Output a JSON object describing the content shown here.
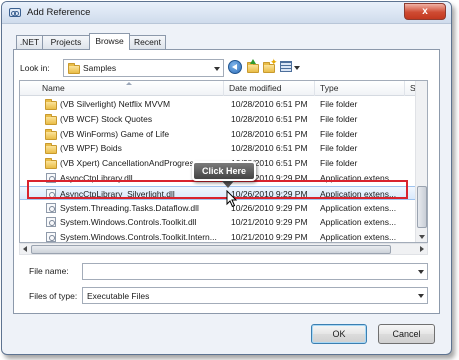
{
  "window": {
    "title": "Add Reference",
    "close_glyph": "x"
  },
  "tabs": [
    {
      "label": ".NET",
      "active": false
    },
    {
      "label": "Projects",
      "active": false
    },
    {
      "label": "Browse",
      "active": true
    },
    {
      "label": "Recent",
      "active": false
    }
  ],
  "lookin": {
    "label": "Look in:",
    "value": "Samples"
  },
  "toolbar": {
    "icons": [
      "back-arrow-icon",
      "up-folder-icon",
      "new-folder-icon",
      "views-menu-icon"
    ]
  },
  "list": {
    "columns": [
      "Name",
      "Date modified",
      "Type",
      "Si"
    ],
    "rows": [
      {
        "name": "(VB Silverlight) Netflix MVVM",
        "date": "10/28/2010 6:51 PM",
        "type": "File folder",
        "icon": "folder"
      },
      {
        "name": "(VB WCF) Stock Quotes",
        "date": "10/28/2010 6:51 PM",
        "type": "File folder",
        "icon": "folder"
      },
      {
        "name": "(VB WinForms) Game of Life",
        "date": "10/28/2010 6:51 PM",
        "type": "File folder",
        "icon": "folder"
      },
      {
        "name": "(VB WPF) Boids",
        "date": "10/28/2010 6:51 PM",
        "type": "File folder",
        "icon": "folder"
      },
      {
        "name": "(VB Xpert) CancellationAndProgres",
        "date": "10/28/2010 6:51 PM",
        "type": "File folder",
        "icon": "folder"
      },
      {
        "name": "AsyncCtpLibrary.dll",
        "date": "10/26/2010 9:29 PM",
        "type": "Application extens...",
        "icon": "dll"
      },
      {
        "name": "AsyncCtpLibrary_Silverlight.dll",
        "date": "10/26/2010 9:29 PM",
        "type": "Application extens...",
        "icon": "dll",
        "selected": true
      },
      {
        "name": "System.Threading.Tasks.Dataflow.dll",
        "date": "10/26/2010 9:29 PM",
        "type": "Application extens...",
        "icon": "dll"
      },
      {
        "name": "System.Windows.Controls.Toolkit.dll",
        "date": "10/21/2010 9:29 PM",
        "type": "Application extens...",
        "icon": "dll"
      },
      {
        "name": "System.Windows.Controls.Toolkit.Intern...",
        "date": "10/21/2010 9:29 PM",
        "type": "Application extens...",
        "icon": "dll"
      }
    ]
  },
  "callout": {
    "text": "Click Here"
  },
  "filename": {
    "label": "File name:",
    "value": ""
  },
  "filetype": {
    "label": "Files of type:",
    "value": "Executable Files"
  },
  "buttons": {
    "ok": "OK",
    "cancel": "Cancel"
  },
  "colors": {
    "highlight": "#d9232e",
    "selection": "#d9e9fc",
    "close_button": "#c2381f"
  }
}
